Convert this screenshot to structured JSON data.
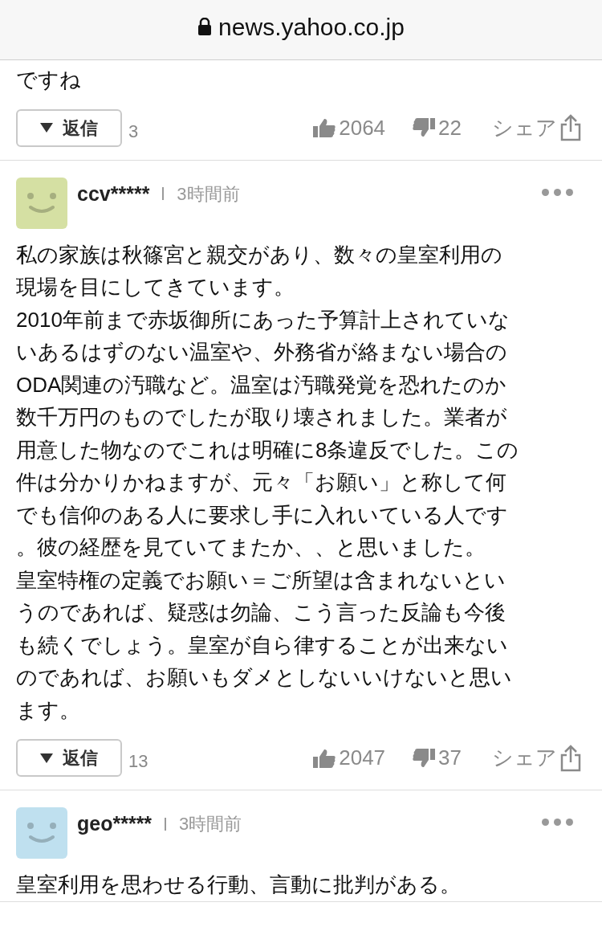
{
  "address_bar": {
    "url": "news.yahoo.co.jp"
  },
  "comments": [
    {
      "text_lines": [
        "ですね"
      ],
      "actions": {
        "reply_label": "返信",
        "reply_count": "3",
        "likes": "2064",
        "dislikes": "22",
        "share_label": "シェア"
      }
    },
    {
      "user": "ccv*****",
      "time": "3時間前",
      "color": "#d5e0a3",
      "text_lines": [
        "私の家族は秋篠宮と親交があり、数々の皇室利用の",
        "現場を目にしてきています。",
        "2010年前まで赤坂御所にあった予算計上されていな",
        "いあるはずのない温室や、外務省が絡まない場合の",
        "ODA関連の汚職など。温室は汚職発覚を恐れたのか",
        "数千万円のものでしたが取り壊されました。業者が",
        "用意した物なのでこれは明確に8条違反でした。この",
        "件は分かりかねますが、元々「お願い」と称して何",
        "でも信仰のある人に要求し手に入れいている人です",
        "。彼の経歴を見ていてまたか、、と思いました。",
        "皇室特権の定義でお願い＝ご所望は含まれないとい",
        "うのであれば、疑惑は勿論、こう言った反論も今後",
        "も続くでしょう。皇室が自ら律することが出来ない",
        "のであれば、お願いもダメとしないいけないと思い",
        "ます。"
      ],
      "actions": {
        "reply_label": "返信",
        "reply_count": "13",
        "likes": "2047",
        "dislikes": "37",
        "share_label": "シェア"
      }
    },
    {
      "user": "geo*****",
      "time": "3時間前",
      "color": "#bfe0ef",
      "text_lines": [
        "皇室利用を思わせる行動、言動に批判がある。"
      ]
    }
  ]
}
